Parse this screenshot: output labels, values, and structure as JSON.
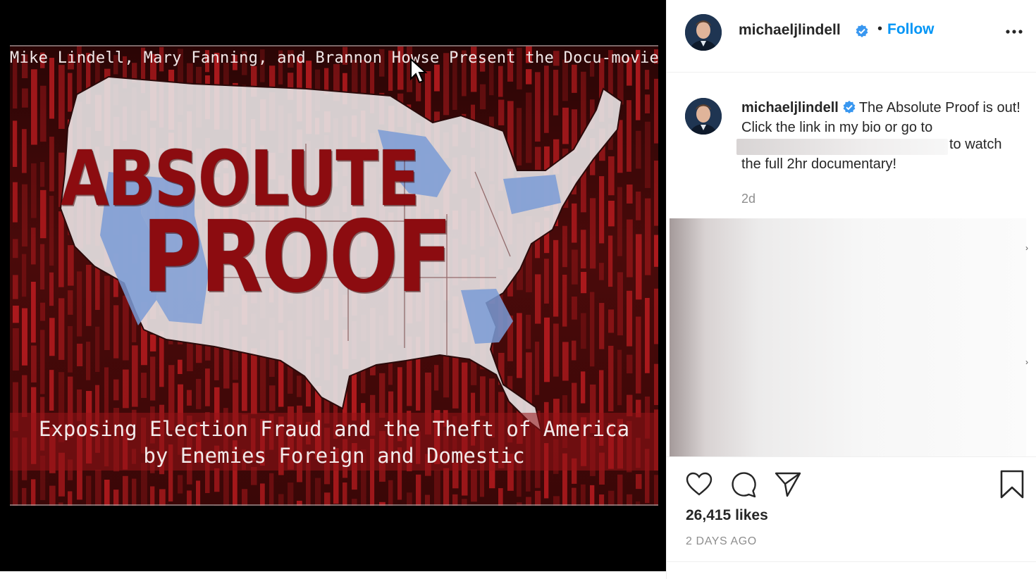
{
  "media": {
    "credit_line": "Mike Lindell, Mary Fanning, and Brannon Howse Present the Docu-movie:",
    "title_line_1": "ABSOLUTE",
    "title_line_2": "PROOF",
    "tagline_1": "Exposing Election Fraud  and the Theft of America",
    "tagline_2": "by Enemies Foreign and Domestic",
    "colors": {
      "background": "#000000",
      "rain": "#c81e22",
      "map_fill": "#e8e4e6",
      "swing_states": "#7a9bd6",
      "title": "#8c0c10"
    }
  },
  "post_header": {
    "username": "michaeljlindell",
    "separator": "•",
    "follow_label": "Follow",
    "verified_icon": "verified-badge-icon",
    "more_icon": "more-options-icon",
    "accent_color": "#0095f6"
  },
  "caption": {
    "username": "michaeljlindell",
    "text_part1": "The Absolute Proof is out! Click the link in my bio or go to",
    "text_part2": "to watch",
    "text_part3": "the full 2hr documentary!",
    "relative_time": "2d"
  },
  "actions": {
    "icons": [
      "heart-icon",
      "comment-icon",
      "share-icon",
      "bookmark-icon"
    ],
    "likes": "26,415 likes",
    "timestamp": "2 DAYS AGO"
  }
}
